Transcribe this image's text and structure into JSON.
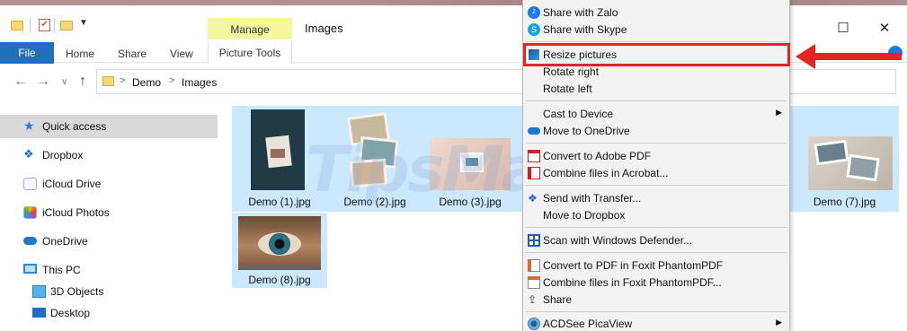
{
  "window": {
    "title": "Images",
    "manage_label": "Manage",
    "picture_tools_label": "Picture Tools",
    "minimize": "—",
    "maximize": "☐",
    "close": "✕"
  },
  "ribbon": {
    "file": "File",
    "tabs": [
      "Home",
      "Share",
      "View"
    ]
  },
  "address": {
    "crumbs": [
      "Demo",
      "Images"
    ],
    "sep": ">"
  },
  "sidebar": {
    "items": [
      {
        "label": "Quick access",
        "icon": "star-icon"
      },
      {
        "label": "Dropbox",
        "icon": "dropbox-icon"
      },
      {
        "label": "iCloud Drive",
        "icon": "icloud-drive-icon"
      },
      {
        "label": "iCloud Photos",
        "icon": "icloud-photos-icon"
      },
      {
        "label": "OneDrive",
        "icon": "onedrive-icon"
      },
      {
        "label": "This PC",
        "icon": "this-pc-icon"
      },
      {
        "label": "3D Objects",
        "icon": "3d-objects-icon"
      },
      {
        "label": "Desktop",
        "icon": "desktop-icon"
      }
    ]
  },
  "files": [
    {
      "name": "Demo (1).jpg"
    },
    {
      "name": "Demo (2).jpg"
    },
    {
      "name": "Demo (3).jpg"
    },
    {
      "name": "Demo (7).jpg"
    },
    {
      "name": "Demo (8).jpg"
    }
  ],
  "watermark": "TipsMake",
  "context_menu": {
    "items": [
      {
        "label": "Share with Zalo",
        "icon": "zalo-icon"
      },
      {
        "label": "Share with Skype",
        "icon": "skype-icon"
      },
      {
        "label": "Resize pictures",
        "icon": "resize-pictures-icon"
      },
      {
        "label": "Rotate right",
        "icon": ""
      },
      {
        "label": "Rotate left",
        "icon": ""
      },
      {
        "label": "Cast to Device",
        "icon": "",
        "submenu": "▶"
      },
      {
        "label": "Move to OneDrive",
        "icon": "onedrive-icon"
      },
      {
        "label": "Convert to Adobe PDF",
        "icon": "adobe-pdf-icon"
      },
      {
        "label": "Combine files in Acrobat...",
        "icon": "acrobat-combine-icon"
      },
      {
        "label": "Send with Transfer...",
        "icon": "dropbox-transfer-icon"
      },
      {
        "label": "Move to Dropbox",
        "icon": ""
      },
      {
        "label": "Scan with Windows Defender...",
        "icon": "windows-defender-icon"
      },
      {
        "label": "Convert to PDF in Foxit PhantomPDF",
        "icon": "foxit-icon"
      },
      {
        "label": "Combine files in Foxit PhantomPDF...",
        "icon": "foxit-combine-icon"
      },
      {
        "label": "Share",
        "icon": "share-icon"
      },
      {
        "label": "ACDSee PicaView",
        "icon": "acdsee-icon",
        "submenu": "▶"
      }
    ]
  },
  "colors": {
    "accent": "#1f6fbd",
    "highlight": "#e52420",
    "selection": "#cce8ff",
    "manage": "#f6f6a0"
  }
}
